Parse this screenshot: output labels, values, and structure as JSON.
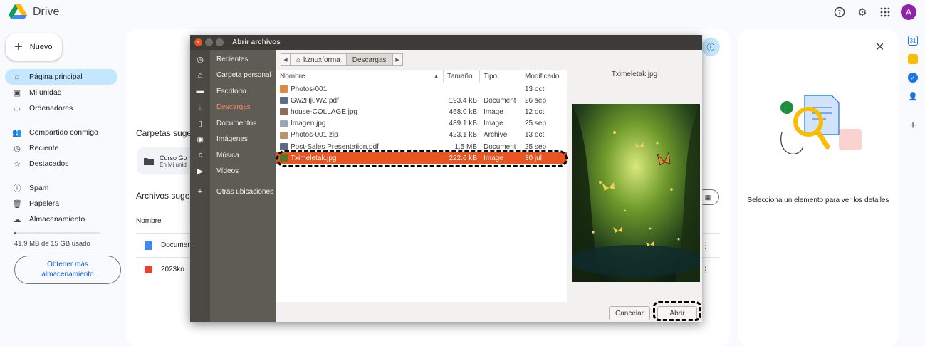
{
  "drive": {
    "app_name": "Drive",
    "avatar_letter": "A",
    "new_label": "Nuevo",
    "nav": {
      "home": "Página principal",
      "my_drive": "Mi unidad",
      "computers": "Ordenadores",
      "shared": "Compartido conmigo",
      "recent": "Reciente",
      "starred": "Destacados",
      "spam": "Spam",
      "trash": "Papelera",
      "storage": "Almacenamiento"
    },
    "storage_used": "41,9 MB de 15 GB usado",
    "storage_fraction": 0.003,
    "more_storage": "Obtener más almacenamiento",
    "suggested_folders_title": "Carpetas suge",
    "folder_card": {
      "name": "Curso Go",
      "sub": "En Mi unid"
    },
    "suggested_files_title": "Archivos suger",
    "col_name": "Nombre",
    "files": [
      {
        "name": "Documen"
      },
      {
        "name": "2023ko"
      }
    ],
    "details_message": "Selecciona un elemento para ver los detalles"
  },
  "dialog": {
    "title": "Abrir archivos",
    "places": [
      {
        "icon": "clock-icon",
        "label": "Recientes"
      },
      {
        "icon": "home-icon",
        "label": "Carpeta personal"
      },
      {
        "icon": "folder-icon",
        "label": "Escritorio"
      },
      {
        "icon": "download-icon",
        "label": "Descargas"
      },
      {
        "icon": "document-icon",
        "label": "Documentos"
      },
      {
        "icon": "camera-icon",
        "label": "Imágenes"
      },
      {
        "icon": "music-icon",
        "label": "Música"
      },
      {
        "icon": "video-icon",
        "label": "Vídeos"
      },
      {
        "icon": "plus-icon",
        "label": "Otras ubicaciones"
      }
    ],
    "path": {
      "home": "kznuxforma",
      "current": "Descargas"
    },
    "columns": {
      "name": "Nombre",
      "size": "Tamaño",
      "type": "Tipo",
      "modified": "Modificado"
    },
    "files": [
      {
        "name": "Photos-001",
        "size": "",
        "type": "",
        "modified": "13 oct",
        "icon": "folder",
        "color": "#e0883e"
      },
      {
        "name": "Gw2HjuWZ.pdf",
        "size": "193.4 kB",
        "type": "Document",
        "modified": "26 sep",
        "icon": "document",
        "color": "#5b6b8a"
      },
      {
        "name": "house-COLLAGE.jpg",
        "size": "468.0 kB",
        "type": "Image",
        "modified": "12 oct",
        "icon": "image",
        "color": "#8a6d5b"
      },
      {
        "name": "Imagen.jpg",
        "size": "489.1 kB",
        "type": "Image",
        "modified": "25 sep",
        "icon": "image",
        "color": "#9aa6b2"
      },
      {
        "name": "Photos-001.zip",
        "size": "423.1 kB",
        "type": "Archive",
        "modified": "13 oct",
        "icon": "archive",
        "color": "#b8946a"
      },
      {
        "name": "Post-Sales Presentation.pdf",
        "size": "1.5 MB",
        "type": "Document",
        "modified": "25 sep",
        "icon": "document",
        "color": "#5b6b8a"
      },
      {
        "name": "Tximeletak.jpg",
        "size": "222.6 kB",
        "type": "Image",
        "modified": "30 jul",
        "icon": "image",
        "color": "#4f7a2a",
        "selected": true
      }
    ],
    "preview_name": "Tximeletak.jpg",
    "cancel": "Cancelar",
    "open": "Abrir"
  }
}
